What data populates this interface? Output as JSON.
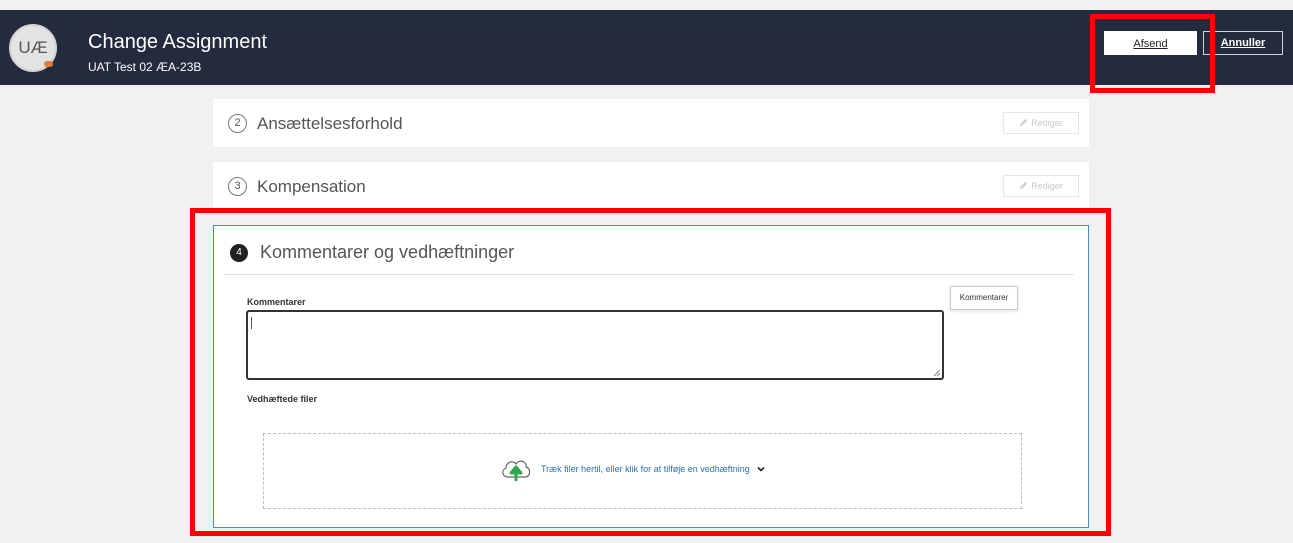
{
  "header": {
    "avatar_initials": "UÆ",
    "title": "Change Assignment",
    "subtitle": "UAT Test 02 ÆA-23B",
    "submit_label": "Afsend",
    "cancel_label": "Annuller"
  },
  "sections": [
    {
      "number": "2",
      "label": "Ansættelsesforhold",
      "edit_label": "Rediger"
    },
    {
      "number": "3",
      "label": "Kompensation",
      "edit_label": "Rediger"
    }
  ],
  "active_section": {
    "number": "4",
    "title": "Kommentarer og vedhæftninger",
    "comments_label": "Kommentarer",
    "comments_value": "",
    "tooltip": "Kommentarer",
    "attachments_label": "Vedhæftede filer",
    "dropzone_text": "Træk filer hertil, eller klik for at tilføje en vedhæftning"
  },
  "colors": {
    "header_bg": "#252b3e",
    "highlight": "#ff0000",
    "active_border": "#3d8fd6",
    "link": "#2a6fb5",
    "upload_arrow": "#2fa84f"
  },
  "icons": [
    "pencil-icon",
    "cloud-upload-icon",
    "chevron-down-icon"
  ]
}
